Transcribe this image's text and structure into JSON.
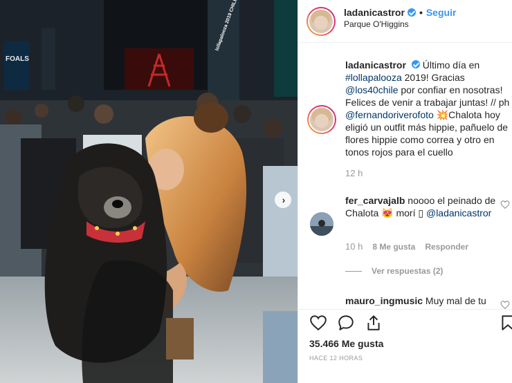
{
  "post": {
    "username": "ladanicastror",
    "follow_label": "Seguir",
    "dot": "•",
    "location": "Parque O'Higgins",
    "caption": {
      "username": "ladanicastror",
      "t1": "Último día en ",
      "tag1": "#lollapalooza",
      "t2": " 2019! Gracias ",
      "mention1": "@los40chile",
      "t3": " por confiar en nosotras! Felices de venir a trabajar juntas! // ph ",
      "mention2": "@fernandoriverofoto",
      "emoji": "💥",
      "t4": "Chalota hoy eligió un outfit más hippie, pañuelo de flores hippie como correa y otro en tonos rojos para el cuello"
    },
    "caption_time": "12 h",
    "comment": {
      "username": "fer_carvajalb",
      "text": " noooo el peinado de Chalota ",
      "emoji": "😻",
      "text2": " morí ",
      "glyph": "▯",
      "mention": "@ladanicastror",
      "time": "10 h",
      "likes": "8 Me gusta",
      "reply": "Responder"
    },
    "view_replies": "Ver respuestas (2)",
    "comment2": {
      "username": "mauro_ingmusic",
      "text": "Muy mal de tu"
    },
    "likes_count": "35.466 Me gusta",
    "time_ago": "HACE 12 HORAS"
  },
  "photo": {
    "stage_sign_left": "FOALS",
    "stage_banner": "lollapalooza 2019 CHILE"
  },
  "icons": [
    "like-icon",
    "comment-icon",
    "share-icon",
    "save-icon",
    "verified-badge",
    "next-arrow-icon"
  ],
  "colors": {
    "link": "#003569",
    "follow": "#3897f0",
    "muted": "#999999"
  }
}
